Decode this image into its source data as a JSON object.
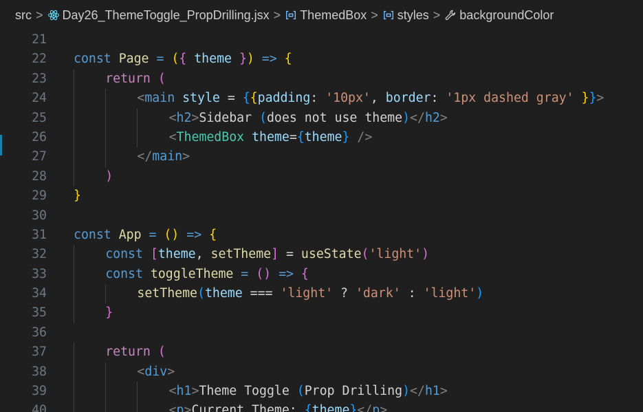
{
  "breadcrumb": [
    {
      "label": "src",
      "icon": "none"
    },
    {
      "label": "Day26_ThemeToggle_PropDrilling.jsx",
      "icon": "react-icon"
    },
    {
      "label": "ThemedBox",
      "icon": "variable-icon"
    },
    {
      "label": "styles",
      "icon": "variable-icon"
    },
    {
      "label": "backgroundColor",
      "icon": "wrench-icon"
    }
  ],
  "colors": {
    "background": "#1f1f1f",
    "line_number": "#6e7681",
    "keyword": "#569cd6",
    "control": "#c586c0",
    "variable": "#9cdcfe",
    "function": "#dcdcaa",
    "string": "#ce9178",
    "component": "#4ec9b0",
    "bracket_gold": "#ffd700",
    "bracket_orchid": "#da70d6",
    "bracket_blue": "#179fff",
    "modified_marker": "#1b81a8"
  },
  "editor": {
    "lines": [
      {
        "n": "21",
        "indent": 0,
        "tokens": []
      },
      {
        "n": "22",
        "indent": 0,
        "tokens": [
          [
            "kw",
            "const"
          ],
          [
            "txt",
            " "
          ],
          [
            "fn",
            "Page"
          ],
          [
            "txt",
            " "
          ],
          [
            "kw",
            "="
          ],
          [
            "txt",
            " "
          ],
          [
            "b1",
            "("
          ],
          [
            "b2",
            "{"
          ],
          [
            "txt",
            " "
          ],
          [
            "var",
            "theme"
          ],
          [
            "txt",
            " "
          ],
          [
            "b2",
            "}"
          ],
          [
            "b1",
            ")"
          ],
          [
            "txt",
            " "
          ],
          [
            "kw",
            "=>"
          ],
          [
            "txt",
            " "
          ],
          [
            "b1",
            "{"
          ]
        ]
      },
      {
        "n": "23",
        "indent": 1,
        "tokens": [
          [
            "ctl",
            "return"
          ],
          [
            "txt",
            " "
          ],
          [
            "b2",
            "("
          ]
        ]
      },
      {
        "n": "24",
        "indent": 2,
        "tokens": [
          [
            "pun",
            "<"
          ],
          [
            "tag",
            "main"
          ],
          [
            "txt",
            " "
          ],
          [
            "attr",
            "style"
          ],
          [
            "txt",
            " "
          ],
          [
            "txt",
            "="
          ],
          [
            "txt",
            " "
          ],
          [
            "b3",
            "{"
          ],
          [
            "b1",
            "{"
          ],
          [
            "attr",
            "padding"
          ],
          [
            "txt",
            ": "
          ],
          [
            "str",
            "'10px'"
          ],
          [
            "txt",
            ", "
          ],
          [
            "attr",
            "border"
          ],
          [
            "txt",
            ": "
          ],
          [
            "str",
            "'1px dashed gray'"
          ],
          [
            "txt",
            " "
          ],
          [
            "b1",
            "}"
          ],
          [
            "b3",
            "}"
          ],
          [
            "pun",
            ">"
          ]
        ]
      },
      {
        "n": "25",
        "indent": 3,
        "tokens": [
          [
            "pun",
            "<"
          ],
          [
            "tag",
            "h2"
          ],
          [
            "pun",
            ">"
          ],
          [
            "txt",
            "Sidebar "
          ],
          [
            "b3",
            "("
          ],
          [
            "txt",
            "does not use theme"
          ],
          [
            "b3",
            ")"
          ],
          [
            "pun",
            "</"
          ],
          [
            "tag",
            "h2"
          ],
          [
            "pun",
            ">"
          ]
        ]
      },
      {
        "n": "26",
        "indent": 3,
        "tokens": [
          [
            "pun",
            "<"
          ],
          [
            "comp",
            "ThemedBox"
          ],
          [
            "txt",
            " "
          ],
          [
            "attr",
            "theme"
          ],
          [
            "txt",
            "="
          ],
          [
            "b3",
            "{"
          ],
          [
            "var",
            "theme"
          ],
          [
            "b3",
            "}"
          ],
          [
            "txt",
            " "
          ],
          [
            "pun",
            "/>"
          ]
        ]
      },
      {
        "n": "27",
        "indent": 2,
        "tokens": [
          [
            "pun",
            "</"
          ],
          [
            "tag",
            "main"
          ],
          [
            "pun",
            ">"
          ]
        ]
      },
      {
        "n": "28",
        "indent": 1,
        "tokens": [
          [
            "b2",
            ")"
          ]
        ]
      },
      {
        "n": "29",
        "indent": 0,
        "tokens": [
          [
            "b1",
            "}"
          ]
        ]
      },
      {
        "n": "30",
        "indent": 0,
        "tokens": []
      },
      {
        "n": "31",
        "indent": 0,
        "tokens": [
          [
            "kw",
            "const"
          ],
          [
            "txt",
            " "
          ],
          [
            "fn",
            "App"
          ],
          [
            "txt",
            " "
          ],
          [
            "kw",
            "="
          ],
          [
            "txt",
            " "
          ],
          [
            "b1",
            "()"
          ],
          [
            "txt",
            " "
          ],
          [
            "kw",
            "=>"
          ],
          [
            "txt",
            " "
          ],
          [
            "b1",
            "{"
          ]
        ]
      },
      {
        "n": "32",
        "indent": 1,
        "tokens": [
          [
            "kw",
            "const"
          ],
          [
            "txt",
            " "
          ],
          [
            "b2",
            "["
          ],
          [
            "var",
            "theme"
          ],
          [
            "txt",
            ", "
          ],
          [
            "fn",
            "setTheme"
          ],
          [
            "b2",
            "]"
          ],
          [
            "txt",
            " = "
          ],
          [
            "fn",
            "useState"
          ],
          [
            "b2",
            "("
          ],
          [
            "str",
            "'light'"
          ],
          [
            "b2",
            ")"
          ]
        ]
      },
      {
        "n": "33",
        "indent": 1,
        "tokens": [
          [
            "kw",
            "const"
          ],
          [
            "txt",
            " "
          ],
          [
            "fn",
            "toggleTheme"
          ],
          [
            "txt",
            " "
          ],
          [
            "kw",
            "="
          ],
          [
            "txt",
            " "
          ],
          [
            "b2",
            "()"
          ],
          [
            "txt",
            " "
          ],
          [
            "kw",
            "=>"
          ],
          [
            "txt",
            " "
          ],
          [
            "b2",
            "{"
          ]
        ]
      },
      {
        "n": "34",
        "indent": 2,
        "tokens": [
          [
            "fn",
            "setTheme"
          ],
          [
            "b3",
            "("
          ],
          [
            "var",
            "theme"
          ],
          [
            "txt",
            " === "
          ],
          [
            "str",
            "'light'"
          ],
          [
            "txt",
            " ? "
          ],
          [
            "str",
            "'dark'"
          ],
          [
            "txt",
            " : "
          ],
          [
            "str",
            "'light'"
          ],
          [
            "b3",
            ")"
          ]
        ]
      },
      {
        "n": "35",
        "indent": 1,
        "tokens": [
          [
            "b2",
            "}"
          ]
        ]
      },
      {
        "n": "36",
        "indent": 0,
        "tokens": []
      },
      {
        "n": "37",
        "indent": 1,
        "tokens": [
          [
            "ctl",
            "return"
          ],
          [
            "txt",
            " "
          ],
          [
            "b2",
            "("
          ]
        ]
      },
      {
        "n": "38",
        "indent": 2,
        "tokens": [
          [
            "pun",
            "<"
          ],
          [
            "tag",
            "div"
          ],
          [
            "pun",
            ">"
          ]
        ]
      },
      {
        "n": "39",
        "indent": 3,
        "tokens": [
          [
            "pun",
            "<"
          ],
          [
            "tag",
            "h1"
          ],
          [
            "pun",
            ">"
          ],
          [
            "txt",
            "Theme Toggle "
          ],
          [
            "b3",
            "("
          ],
          [
            "txt",
            "Prop Drilling"
          ],
          [
            "b3",
            ")"
          ],
          [
            "pun",
            "</"
          ],
          [
            "tag",
            "h1"
          ],
          [
            "pun",
            ">"
          ]
        ]
      },
      {
        "n": "40",
        "indent": 3,
        "tokens": [
          [
            "pun",
            "<"
          ],
          [
            "tag",
            "p"
          ],
          [
            "pun",
            ">"
          ],
          [
            "txt",
            "Current Theme: "
          ],
          [
            "b3",
            "{"
          ],
          [
            "var",
            "theme"
          ],
          [
            "b3",
            "}"
          ],
          [
            "pun",
            "</"
          ],
          [
            "tag",
            "p"
          ],
          [
            "pun",
            ">"
          ]
        ]
      }
    ]
  }
}
